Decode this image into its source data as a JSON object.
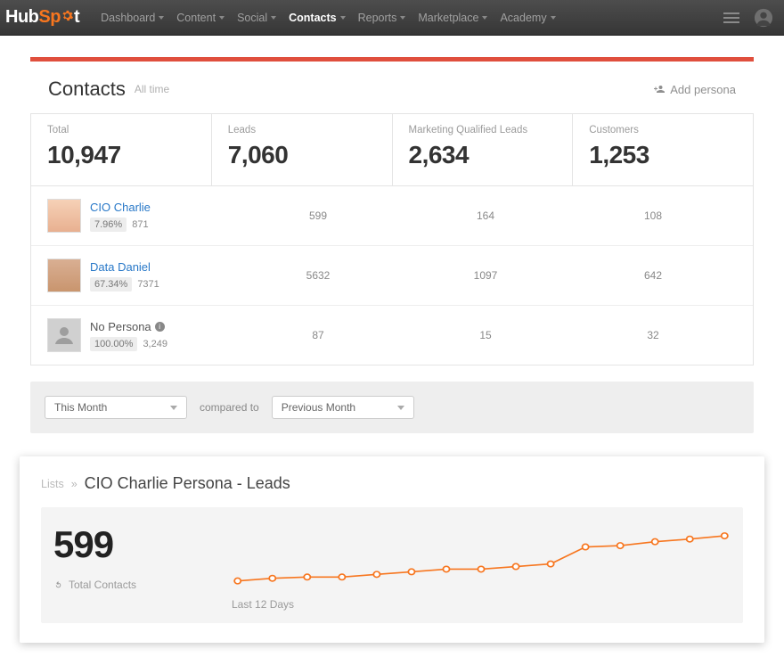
{
  "logo": {
    "text1": "Hub",
    "text2": "Sp",
    "text3": "t"
  },
  "nav": {
    "items": [
      {
        "label": "Dashboard",
        "active": false
      },
      {
        "label": "Content",
        "active": false
      },
      {
        "label": "Social",
        "active": false
      },
      {
        "label": "Contacts",
        "active": true
      },
      {
        "label": "Reports",
        "active": false
      },
      {
        "label": "Marketplace",
        "active": false
      },
      {
        "label": "Academy",
        "active": false
      }
    ]
  },
  "card": {
    "title": "Contacts",
    "subtitle": "All time",
    "action": "Add persona"
  },
  "metrics": [
    {
      "label": "Total",
      "value": "10,947"
    },
    {
      "label": "Leads",
      "value": "7,060"
    },
    {
      "label": "Marketing Qualified Leads",
      "value": "2,634"
    },
    {
      "label": "Customers",
      "value": "1,253"
    }
  ],
  "personas": [
    {
      "name": "CIO Charlie",
      "pct": "7.96%",
      "sum": "871",
      "cells": [
        "599",
        "164",
        "108"
      ],
      "link": true,
      "avatar": "face1"
    },
    {
      "name": "Data Daniel",
      "pct": "67.34%",
      "sum": "7371",
      "cells": [
        "5632",
        "1097",
        "642"
      ],
      "link": true,
      "avatar": "face2"
    },
    {
      "name": "No Persona",
      "pct": "100.00%",
      "sum": "3,249",
      "cells": [
        "87",
        "15",
        "32"
      ],
      "link": false,
      "avatar": "placeholder"
    }
  ],
  "compare": {
    "period": "This Month",
    "label": "compared to",
    "baseline": "Previous Month"
  },
  "panel": {
    "crumb_root": "Lists",
    "crumb_title": "CIO Charlie Persona - Leads",
    "big_number": "599",
    "total_label": "Total Contacts",
    "chart_caption": "Last 12 Days"
  },
  "chart_data": {
    "type": "line",
    "title": "CIO Charlie Persona - Leads",
    "xlabel": "Last 12 Days",
    "ylabel": "Total Contacts",
    "x": [
      1,
      2,
      3,
      4,
      5,
      6,
      7,
      8,
      9,
      10,
      11,
      12,
      13,
      14,
      15
    ],
    "values": [
      530,
      534,
      536,
      536,
      540,
      544,
      548,
      548,
      552,
      556,
      582,
      584,
      590,
      594,
      599
    ],
    "ylim": [
      520,
      610
    ],
    "color": "#f7761f",
    "total": 599
  }
}
